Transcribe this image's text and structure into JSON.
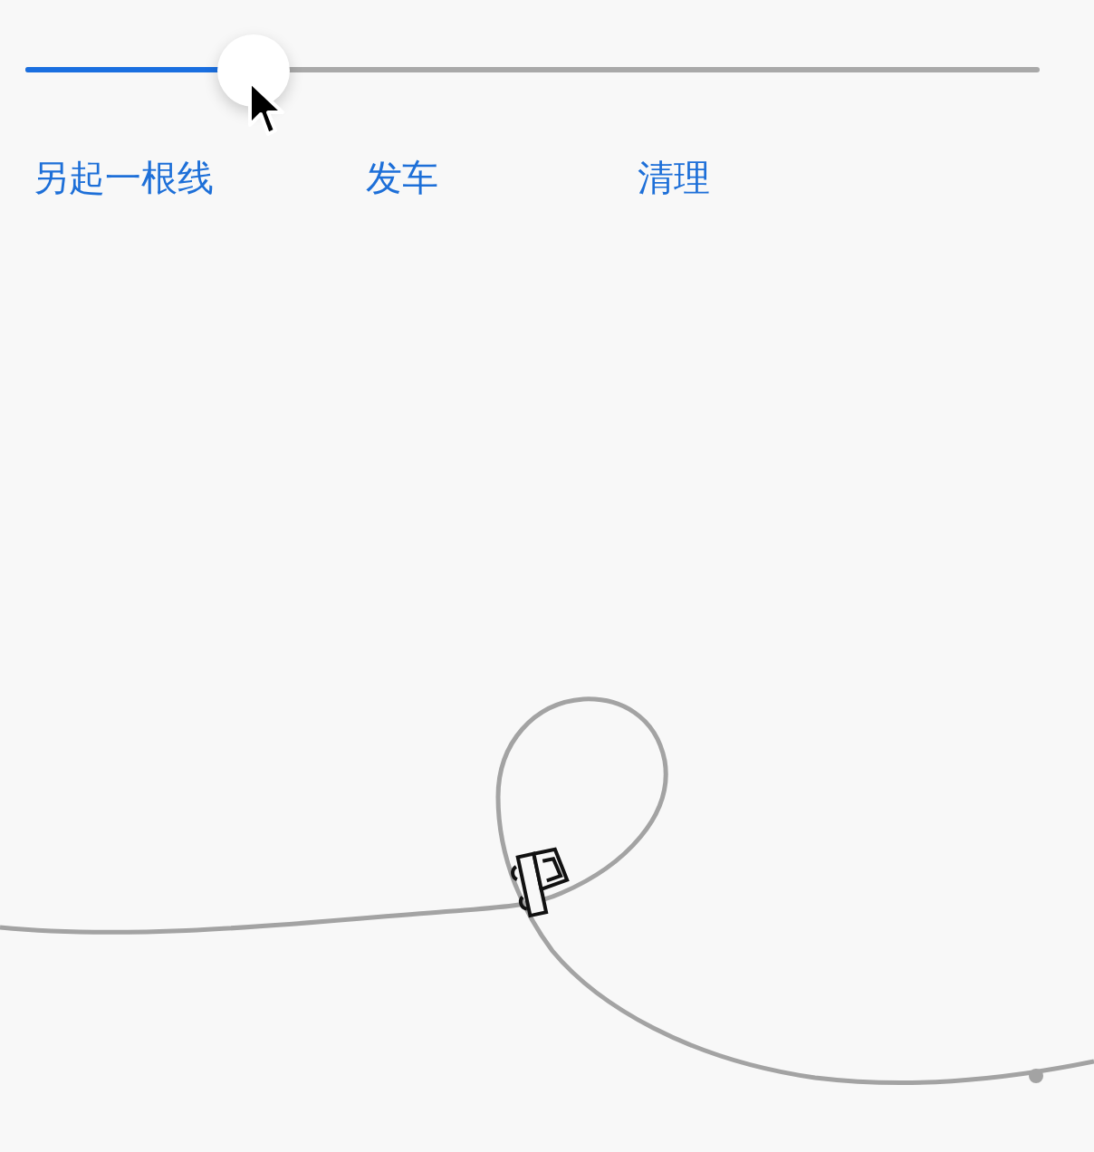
{
  "slider": {
    "level": 0.225
  },
  "buttons": [
    "另起一根线",
    "发车",
    "清理"
  ]
}
